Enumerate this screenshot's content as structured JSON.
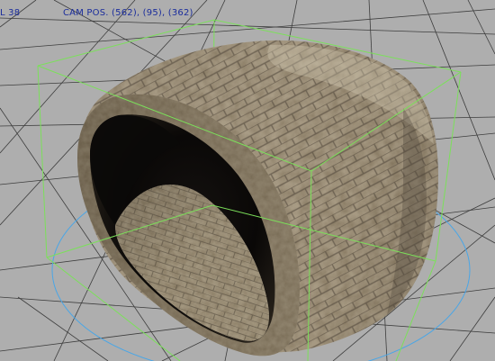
{
  "viewport": {
    "background_color": "#aeaeae",
    "grid_color": "#2a2a2a",
    "bounding_box_color": "#7be05a",
    "orbit_circle_color": "#4aa6e6",
    "hud_text_color": "#1b2d9c"
  },
  "hud": {
    "left_text": "L 38",
    "camera_text": "CAM POS. (562), (95), (362)"
  },
  "model": {
    "name_icon": "textured-tire-model"
  }
}
